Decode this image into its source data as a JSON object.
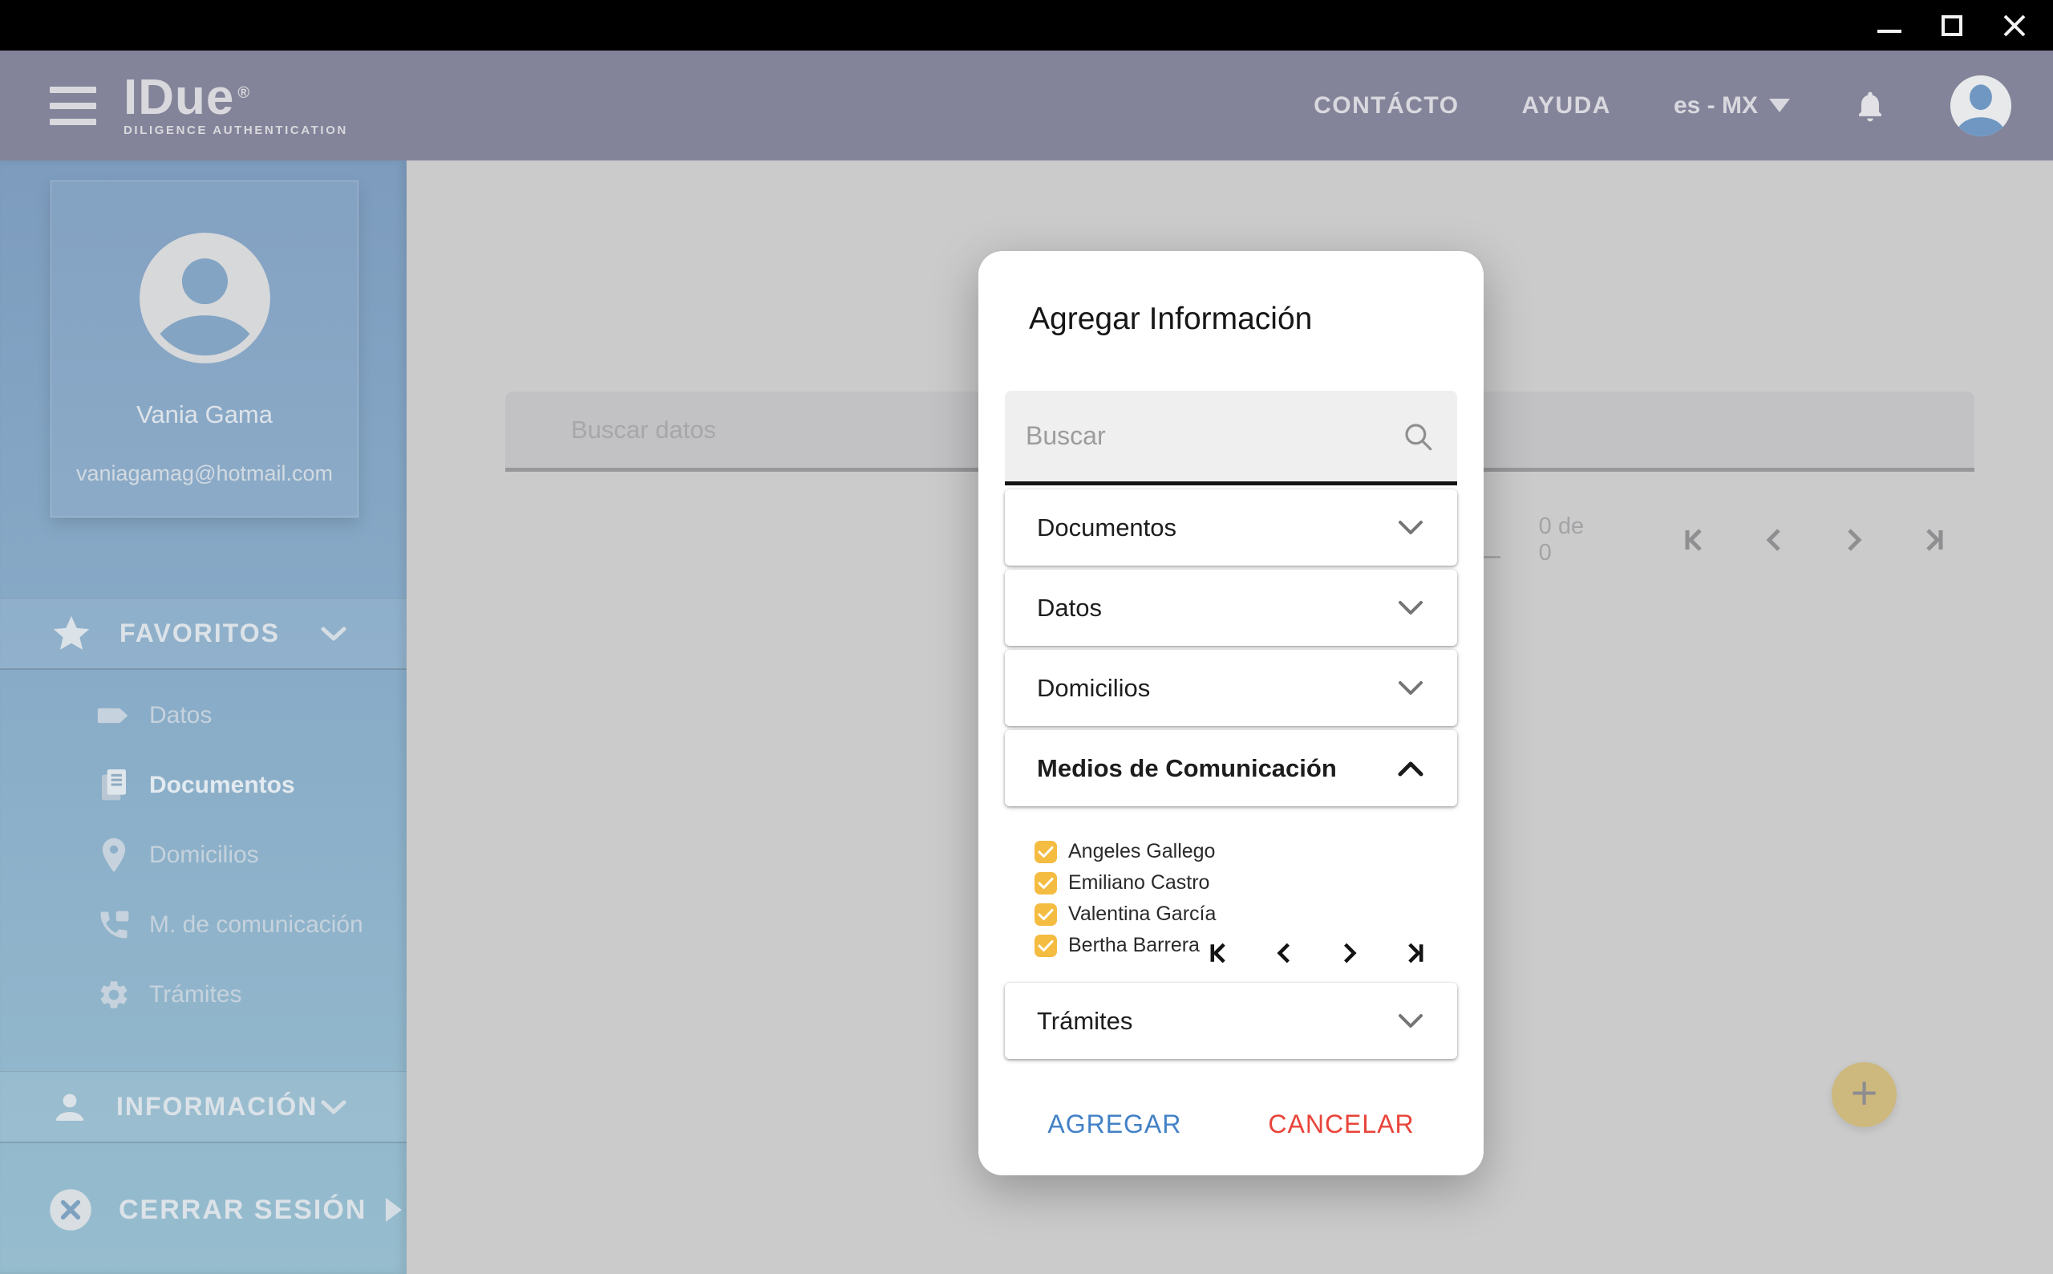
{
  "window": {
    "controls": {
      "minimize": "minimize",
      "maximize": "maximize",
      "close": "close"
    }
  },
  "header": {
    "logo": {
      "title": "IDue",
      "registered": "®",
      "subtitle": "DILIGENCE AUTHENTICATION"
    },
    "nav": [
      {
        "label": "CONTÁCTO"
      },
      {
        "label": "AYUDA"
      }
    ],
    "language": "es - MX",
    "icons": [
      "hamburger-icon",
      "bell-icon",
      "avatar"
    ]
  },
  "sidebar": {
    "profile": {
      "name": "Vania Gama",
      "email": "vaniagamag@hotmail.com"
    },
    "favoritos_label": "FAVORITOS",
    "favorites_items": [
      {
        "label": "Datos",
        "icon": "tag-icon",
        "active": false
      },
      {
        "label": "Documentos",
        "icon": "documents-icon",
        "active": true
      },
      {
        "label": "Domicilios",
        "icon": "location-pin-icon",
        "active": false
      },
      {
        "label": "M. de comunicación",
        "icon": "phone-icon",
        "active": false
      },
      {
        "label": "Trámites",
        "icon": "gear-icon",
        "active": false
      }
    ],
    "informacion_label": "INFORMACIÓN",
    "logout_label": "CERRAR SESIÓN"
  },
  "content": {
    "search_placeholder": "Buscar datos",
    "pagination": {
      "range_label": "0 de 0"
    },
    "fab_label": "+"
  },
  "modal": {
    "title": "Agregar Información",
    "search_placeholder": "Buscar",
    "accordions": [
      {
        "label": "Documentos",
        "expanded": false
      },
      {
        "label": "Datos",
        "expanded": false
      },
      {
        "label": "Domicilios",
        "expanded": false
      },
      {
        "label": "Medios de Comunicación",
        "expanded": true
      },
      {
        "label": "Trámites",
        "expanded": false
      }
    ],
    "contacts": [
      {
        "label": "Angeles Gallego",
        "checked": true
      },
      {
        "label": "Emiliano Castro",
        "checked": true
      },
      {
        "label": "Valentina García",
        "checked": true
      },
      {
        "label": "Bertha Barrera",
        "checked": true
      }
    ],
    "buttons": {
      "confirm": "AGREGAR",
      "cancel": "CANCELAR"
    }
  },
  "colors": {
    "checkbox_accent": "#F5BC42",
    "confirm_blue": "#4281C6",
    "cancel_red": "#E9443A",
    "header_bar": "#83839A",
    "sidebar_top": "#7D9CBE",
    "sidebar_bottom": "#96BDCE",
    "fab": "#CDB87E"
  }
}
